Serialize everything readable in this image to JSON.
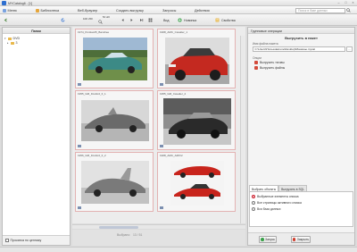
{
  "window": {
    "title": "MYCatalog6 - [1]",
    "min": "–",
    "max": "□",
    "close": "×"
  },
  "menu": {
    "items": [
      "Меню",
      "Библиотека",
      "Веб-браузер",
      "Создать выгрузку",
      "Запросы",
      "Действия"
    ],
    "search_placeholder": "Поиск в базе данных"
  },
  "toolbar": {
    "view_value": "100 x50",
    "view_value_small": "50 x20",
    "view_label": "Вид",
    "new_label": "Новинка",
    "props_label": "Свойства",
    "group_ops_label": "Групповые операции"
  },
  "left_panel": {
    "title": "Папки",
    "tree": [
      {
        "label": "DVD",
        "expanded": true
      },
      {
        "label": "3",
        "expanded": false
      }
    ],
    "footer_label": "Прокатка по ценнику"
  },
  "grid": {
    "cells": [
      {
        "label": "1974_Pontiac25_Banshee"
      },
      {
        "label": "1968_AMC_Cavalier_1"
      },
      {
        "label": "1955_GM_Firebird_II_1"
      },
      {
        "label": "1955_GM_Cavalier_2"
      },
      {
        "label": "1956_GM_Firebird_II_2"
      },
      {
        "label": "1968_AMC_AMX/2"
      }
    ],
    "status_label": "Выбрано:",
    "status_value": "13 / 51"
  },
  "right_panel": {
    "header": "Групповые операции",
    "subtitle": "Выгрузить в пакет",
    "folder_label": "Имя файла пакета",
    "folder_path": "C:\\Users\\Пользователь\\Desktop\\Машины.mycat",
    "folder_button": "...",
    "options_label": "Опции",
    "options": [
      "Выгрузить тэговы",
      "Выгрузить файлы"
    ],
    "tabs": [
      "Выбрать объекты",
      "Выгрузить в SQL"
    ],
    "radios": [
      {
        "label": "Выбранные элементы списка",
        "checked": true
      },
      {
        "label": "Все страницы активного списка",
        "checked": false
      },
      {
        "label": "Вся база данных",
        "checked": false
      }
    ],
    "start_button": "Запуск",
    "close_button": "Закрыть"
  },
  "colors": {
    "accent": "#2e6fd0",
    "folder": "#e8b84a",
    "option_red": "#d34a3a",
    "start_green": "#3aa14a",
    "close_red": "#d13b2b",
    "cell_border": "#e3b2b2"
  }
}
